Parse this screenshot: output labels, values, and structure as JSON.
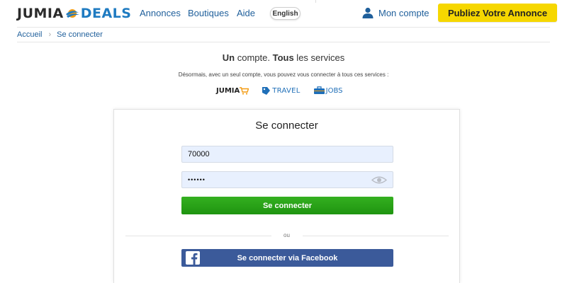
{
  "header": {
    "logo_left": "JUMIA",
    "logo_right": "DEALS",
    "nav": [
      "Annonces",
      "Boutiques",
      "Aide"
    ],
    "language_button": "English",
    "account_label": "Mon compte",
    "publish_button": "Publiez Votre Annonce"
  },
  "breadcrumb": {
    "home": "Accueil",
    "current": "Se connecter"
  },
  "intro": {
    "headline_part1": "Un",
    "headline_part2": " compte. ",
    "headline_part3": "Tous",
    "headline_part4": " les services",
    "subline": "Désormais, avec un seul compte, vous pouvez vous connecter à tous ces services :",
    "brands": {
      "jumia": "JUMIA",
      "travel": "TRAVEL",
      "jobs": "JOBS"
    }
  },
  "login": {
    "title": "Se connecter",
    "username_value": "70000",
    "password_value": "••••••",
    "submit_button": "Se connecter",
    "separator": "ou",
    "facebook_button": "Se connecter via Facebook"
  },
  "colors": {
    "brand_blue": "#1f7bc1",
    "publish_yellow": "#f6d700",
    "login_green": "#24a016",
    "facebook_blue": "#3b5a9a",
    "input_fill": "#e8f0fe"
  },
  "icons": [
    "deals-sun-icon",
    "user-icon",
    "eye-icon",
    "facebook-icon",
    "cart-icon",
    "travel-tag-icon",
    "jobs-briefcase-icon"
  ]
}
